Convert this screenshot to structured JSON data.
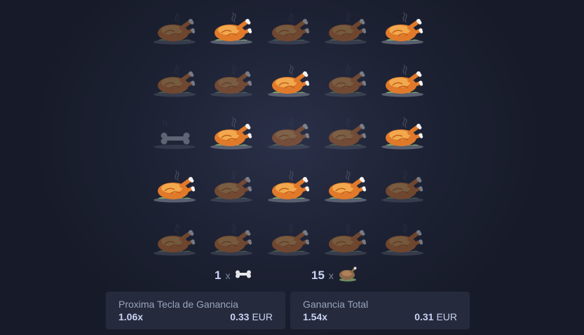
{
  "grid": {
    "rows": 5,
    "cols": 5,
    "tiles": [
      [
        "turkey-dim",
        "turkey",
        "turkey-dim",
        "turkey-dim",
        "turkey"
      ],
      [
        "turkey-dim",
        "turkey-dim",
        "turkey",
        "turkey-dim",
        "turkey"
      ],
      [
        "bone",
        "turkey",
        "turkey-dim",
        "turkey-dim",
        "turkey"
      ],
      [
        "turkey",
        "turkey-dim",
        "turkey",
        "turkey",
        "turkey-dim"
      ],
      [
        "turkey-dim",
        "turkey-dim",
        "turkey-dim",
        "turkey-dim",
        "turkey-dim"
      ]
    ]
  },
  "counters": {
    "bones": {
      "count": "1",
      "x": "x",
      "icon": "bone-icon"
    },
    "turkeys": {
      "count": "15",
      "x": "x",
      "icon": "turkey-icon"
    }
  },
  "next_panel": {
    "title": "Proxima Tecla de Ganancia",
    "multiplier": "1.06x",
    "amount": "0.33",
    "currency": "EUR"
  },
  "total_panel": {
    "title": "Ganancia Total",
    "multiplier": "1.54x",
    "amount": "0.31",
    "currency": "EUR"
  },
  "colors": {
    "background": "#1d2234",
    "panel": "#252b3d",
    "turkey_body": "#e07a2a",
    "turkey_light": "#f2a94e",
    "plate": "#7fa86a"
  }
}
